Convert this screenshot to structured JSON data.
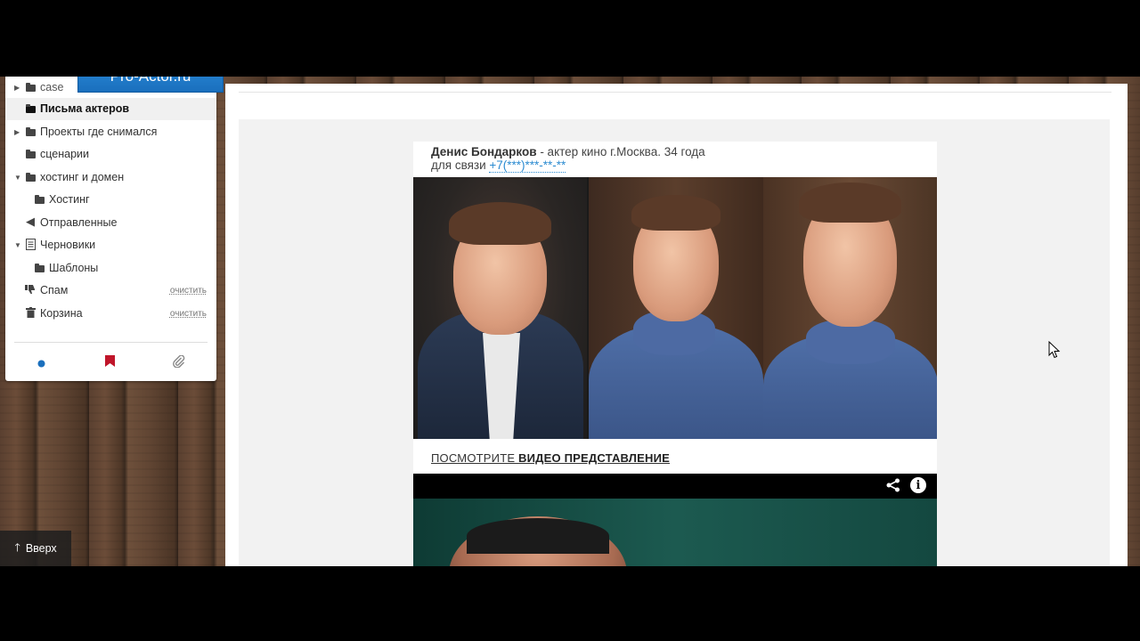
{
  "brand": {
    "title": "Pro-Actor.ru"
  },
  "sidebar": {
    "folders": [
      {
        "label": "case",
        "caret": "right",
        "icon": "folder-icon"
      },
      {
        "label": "Письма актеров",
        "active": true,
        "icon": "folder-icon"
      },
      {
        "label": "Проекты где снимался",
        "caret": "right",
        "icon": "folder-icon"
      },
      {
        "label": "сценарии",
        "icon": "folder-icon"
      },
      {
        "label": "хостинг и домен",
        "caret": "down",
        "icon": "folder-icon"
      },
      {
        "label": "Хостинг",
        "indent": true,
        "icon": "folder-icon"
      },
      {
        "label": "Отправленные",
        "icon": "reply-icon"
      },
      {
        "label": "Черновики",
        "caret": "down",
        "icon": "draft-icon"
      },
      {
        "label": "Шаблоны",
        "indent": true,
        "icon": "folder-icon"
      },
      {
        "label": "Спам",
        "icon": "thumbs-down-icon",
        "action": "очистить"
      },
      {
        "label": "Корзина",
        "icon": "trash-icon",
        "action": "очистить"
      }
    ],
    "footer_icons": [
      "unread-dot-icon",
      "bookmark-icon",
      "paperclip-icon"
    ],
    "colors": {
      "dot": "#1a6fbd",
      "bookmark": "#c0152a",
      "clip": "#888888"
    }
  },
  "up_button": {
    "label": "Вверх"
  },
  "letter": {
    "name": "Денис Бондарков",
    "description": " - актер кино г.Москва. 34 года",
    "contact_prefix": "для связи ",
    "phone": "+7(***)***-**-**",
    "video_link_prefix": "ПОСМОТРИТЕ ",
    "video_link_bold": "ВИДЕО ПРЕДСТАВЛЕНИЕ"
  },
  "video": {
    "icons": [
      "share-icon",
      "info-icon"
    ],
    "info_glyph": "i"
  }
}
